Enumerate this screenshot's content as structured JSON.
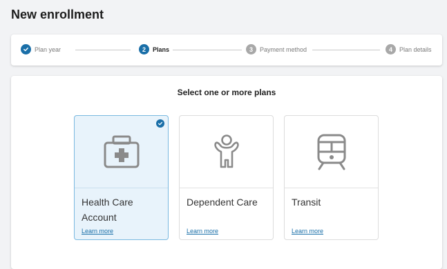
{
  "page": {
    "title": "New enrollment"
  },
  "stepper": {
    "steps": [
      {
        "number": "1",
        "label": "Plan year",
        "state": "done"
      },
      {
        "number": "2",
        "label": "Plans",
        "state": "active"
      },
      {
        "number": "3",
        "label": "Payment method",
        "state": "pending"
      },
      {
        "number": "4",
        "label": "Plan details",
        "state": "pending"
      }
    ]
  },
  "plans": {
    "heading": "Select one or more plans",
    "items": [
      {
        "name": "Health Care Account",
        "link": "Learn more",
        "icon": "medical-kit-icon",
        "selected": true
      },
      {
        "name": "Dependent Care",
        "link": "Learn more",
        "icon": "child-icon",
        "selected": false
      },
      {
        "name": "Transit",
        "link": "Learn more",
        "icon": "train-icon",
        "selected": false
      }
    ]
  },
  "colors": {
    "accent": "#1a6fa8",
    "selected_bg": "#e8f3fb",
    "selected_border": "#79b8e0",
    "icon_gray": "#8a8a8a",
    "pending_step": "#a8a8a8"
  }
}
